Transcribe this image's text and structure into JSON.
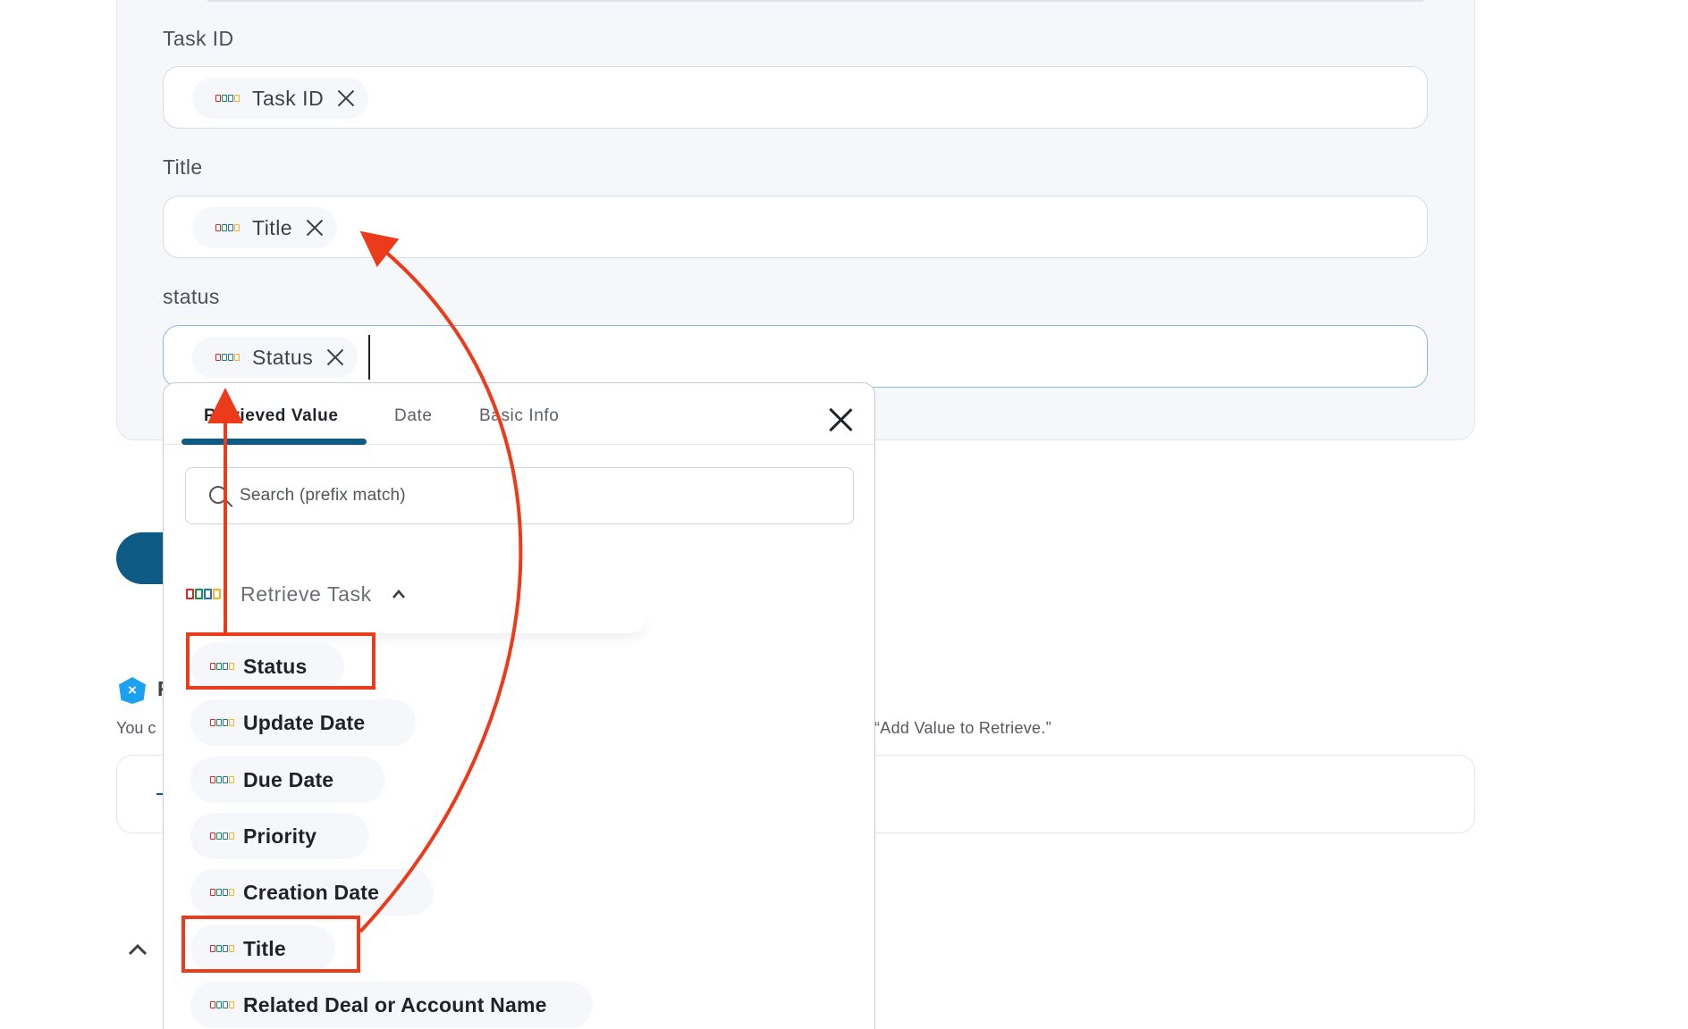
{
  "fields": [
    {
      "label": "Task ID",
      "chip": "Task ID"
    },
    {
      "label": "Title",
      "chip": "Title"
    },
    {
      "label": "status",
      "chip": "Status"
    }
  ],
  "background": {
    "side_letter": "F",
    "you_text": "You c",
    "hint_text": "“Add Value to Retrieve.”"
  },
  "dropdown": {
    "tabs": [
      "Retrieved Value",
      "Date",
      "Basic Info"
    ],
    "active_tab": "Retrieved Value",
    "search_placeholder": "Search (prefix match)",
    "group": {
      "name": "Retrieve Task",
      "expanded": true,
      "logo_text": "ZOHO",
      "items": [
        "Status",
        "Update Date",
        "Due Date",
        "Priority",
        "Creation Date",
        "Title",
        "Related Deal or Account Name"
      ]
    }
  },
  "annotations": {
    "highlighted_items": [
      "Status",
      "Title"
    ],
    "highlight_color": "#ec3b1b"
  },
  "colors": {
    "accent": "#0d5a84",
    "card_bg": "#f6f7fb",
    "active_border": "#8fb6e6",
    "hex_icon": "#1aa1f0"
  }
}
